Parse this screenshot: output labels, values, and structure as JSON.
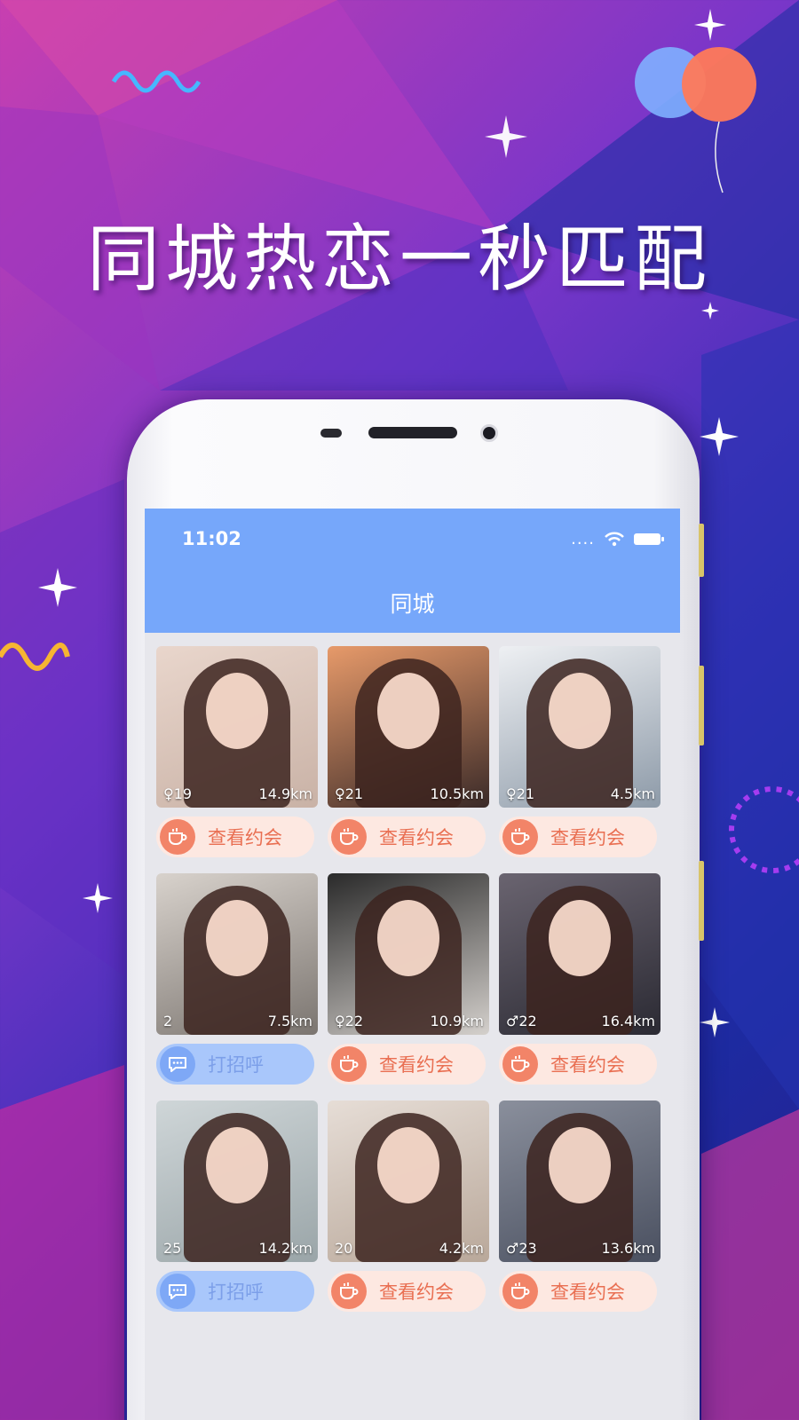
{
  "headline": "同城热恋一秒匹配",
  "status_bar": {
    "time": "11:02",
    "signal": "...."
  },
  "nav": {
    "title": "同城"
  },
  "colors": {
    "header": "#76a7fa",
    "date_accent": "#f28468",
    "greet_accent": "#7ea8f6"
  },
  "cards": [
    {
      "gender": "♀",
      "age": "19",
      "distance": "14.9km",
      "action": "查看约会",
      "action_type": "date"
    },
    {
      "gender": "♀",
      "age": "21",
      "distance": "10.5km",
      "action": "查看约会",
      "action_type": "date"
    },
    {
      "gender": "♀",
      "age": "21",
      "distance": "4.5km",
      "action": "查看约会",
      "action_type": "date"
    },
    {
      "gender": "",
      "age": "2",
      "distance": "7.5km",
      "action": "打招呼",
      "action_type": "greet"
    },
    {
      "gender": "♀",
      "age": "22",
      "distance": "10.9km",
      "action": "查看约会",
      "action_type": "date"
    },
    {
      "gender": "♂",
      "age": "22",
      "distance": "16.4km",
      "action": "查看约会",
      "action_type": "date"
    },
    {
      "gender": "",
      "age": "25",
      "distance": "14.2km",
      "action": "打招呼",
      "action_type": "greet"
    },
    {
      "gender": "",
      "age": "20",
      "distance": "4.2km",
      "action": "查看约会",
      "action_type": "date"
    },
    {
      "gender": "♂",
      "age": "23",
      "distance": "13.6km",
      "action": "查看约会",
      "action_type": "date"
    }
  ]
}
